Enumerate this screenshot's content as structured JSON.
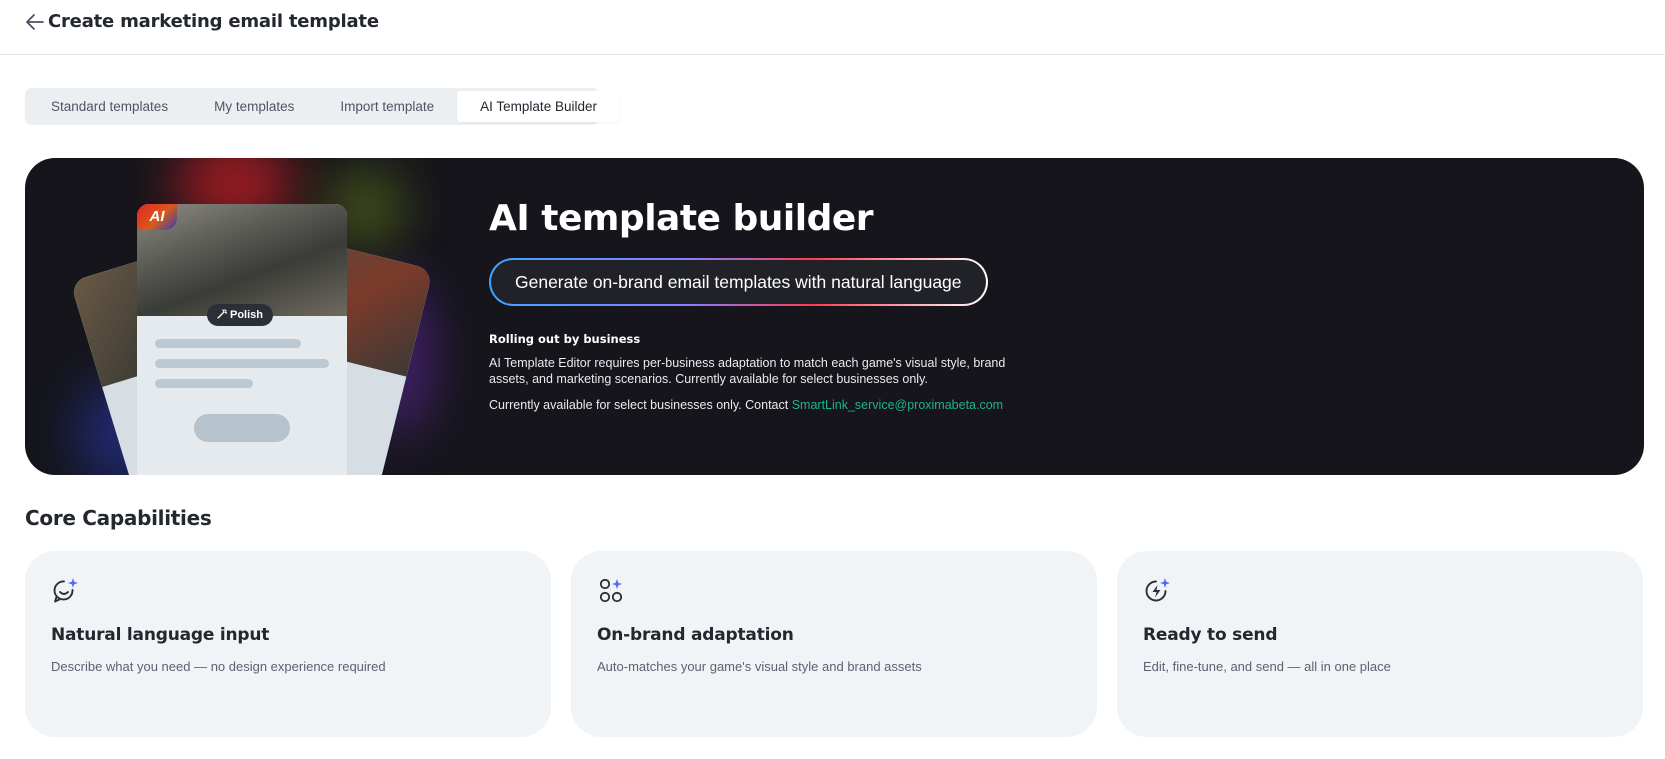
{
  "header": {
    "title": "Create marketing email template",
    "back_icon": "arrow-left-icon"
  },
  "tabs": [
    {
      "label": "Standard templates",
      "active": false
    },
    {
      "label": "My templates",
      "active": false
    },
    {
      "label": "Import template",
      "active": false
    },
    {
      "label": "AI Template Builder",
      "active": true
    }
  ],
  "hero": {
    "title": "AI template builder",
    "tagline": "Generate on-brand email templates with natural language",
    "preview": {
      "ai_badge": "AI",
      "polish_label": "Polish",
      "polish_icon": "magic-wand-icon"
    },
    "rollout_title": "Rolling out by business",
    "rollout_desc": "AI Template Editor requires per-business adaptation to match each game's visual style, brand assets, and marketing scenarios. Currently available for select businesses only.",
    "contact_text": "Currently available for select businesses only. Contact ",
    "contact_email": "SmartLink_service@proximabeta.com"
  },
  "capabilities": {
    "title": "Core Capabilities",
    "items": [
      {
        "icon": "chat-sparkle-icon",
        "title": "Natural language input",
        "desc": "Describe what you need — no design experience required"
      },
      {
        "icon": "shapes-sparkle-icon",
        "title": "On-brand adaptation",
        "desc": "Auto-matches your game's visual style and brand assets"
      },
      {
        "icon": "bolt-sparkle-icon",
        "title": "Ready to send",
        "desc": "Edit, fine-tune, and send — all in one place"
      }
    ]
  },
  "colors": {
    "hero_bg": "#15151b",
    "card_bg": "#f1f4f7",
    "link": "#1fb38a",
    "sparkle": "#4a6cf7"
  }
}
